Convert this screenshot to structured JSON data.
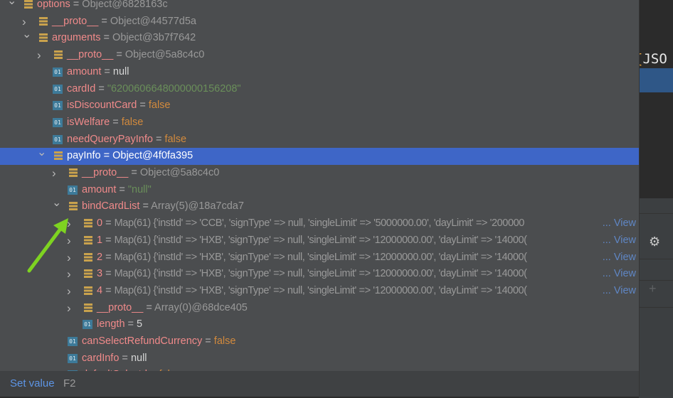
{
  "editor": {
    "code_brace": "{",
    "code_text": "JSO"
  },
  "tree": {
    "rows": [
      {
        "level": 0,
        "expand": "open",
        "icon": "object",
        "key": "options",
        "value": "Object@6828163c",
        "vtype": "ref"
      },
      {
        "level": 1,
        "expand": "closed",
        "icon": "object",
        "key": "__proto__",
        "value": "Object@44577d5a",
        "vtype": "ref"
      },
      {
        "level": 1,
        "expand": "open",
        "icon": "object",
        "key": "arguments",
        "value": "Object@3b7f7642",
        "vtype": "ref"
      },
      {
        "level": 2,
        "expand": "closed",
        "icon": "object",
        "key": "__proto__",
        "value": "Object@5a8c4c0",
        "vtype": "ref"
      },
      {
        "level": 2,
        "expand": "none",
        "icon": "primitive",
        "key": "amount",
        "value": "null",
        "vtype": "null"
      },
      {
        "level": 2,
        "expand": "none",
        "icon": "primitive",
        "key": "cardId",
        "value": "\"6200606648000000156208\"",
        "vtype": "str"
      },
      {
        "level": 2,
        "expand": "none",
        "icon": "primitive",
        "key": "isDiscountCard",
        "value": "false",
        "vtype": "bool"
      },
      {
        "level": 2,
        "expand": "none",
        "icon": "primitive",
        "key": "isWelfare",
        "value": "false",
        "vtype": "bool"
      },
      {
        "level": 2,
        "expand": "none",
        "icon": "primitive",
        "key": "needQueryPayInfo",
        "value": "false",
        "vtype": "bool"
      },
      {
        "level": 2,
        "expand": "open",
        "icon": "object",
        "key": "payInfo",
        "value": "Object@4f0fa395",
        "vtype": "ref",
        "selected": true
      },
      {
        "level": 3,
        "expand": "closed",
        "icon": "object",
        "key": "__proto__",
        "value": "Object@5a8c4c0",
        "vtype": "ref"
      },
      {
        "level": 3,
        "expand": "none",
        "icon": "primitive",
        "key": "amount",
        "value": "\"null\"",
        "vtype": "str"
      },
      {
        "level": 3,
        "expand": "open",
        "icon": "object",
        "key": "bindCardList",
        "value": "Array(5)@18a7cda7",
        "vtype": "ref"
      },
      {
        "level": 4,
        "expand": "closed",
        "icon": "object",
        "key": "0",
        "value": "Map(61) {'instId' => 'CCB', 'signType' => null, 'singleLimit' => '5000000.00', 'dayLimit' => '200000",
        "vtype": "map",
        "view": "View"
      },
      {
        "level": 4,
        "expand": "closed",
        "icon": "object",
        "key": "1",
        "value": "Map(61) {'instId' => 'HXB', 'signType' => null, 'singleLimit' => '12000000.00', 'dayLimit' => '14000(",
        "vtype": "map",
        "view": "View"
      },
      {
        "level": 4,
        "expand": "closed",
        "icon": "object",
        "key": "2",
        "value": "Map(61) {'instId' => 'HXB', 'signType' => null, 'singleLimit' => '12000000.00', 'dayLimit' => '14000(",
        "vtype": "map",
        "view": "View"
      },
      {
        "level": 4,
        "expand": "closed",
        "icon": "object",
        "key": "3",
        "value": "Map(61) {'instId' => 'HXB', 'signType' => null, 'singleLimit' => '12000000.00', 'dayLimit' => '14000(",
        "vtype": "map",
        "view": "View"
      },
      {
        "level": 4,
        "expand": "closed",
        "icon": "object",
        "key": "4",
        "value": "Map(61) {'instId' => 'HXB', 'signType' => null, 'singleLimit' => '12000000.00', 'dayLimit' => '14000(",
        "vtype": "map",
        "view": "View"
      },
      {
        "level": 4,
        "expand": "closed",
        "icon": "object",
        "key": "__proto__",
        "value": "Array(0)@68dce405",
        "vtype": "ref"
      },
      {
        "level": 4,
        "expand": "none",
        "icon": "primitive",
        "key": "length",
        "value": "5",
        "vtype": "num"
      },
      {
        "level": 3,
        "expand": "none",
        "icon": "primitive",
        "key": "canSelectRefundCurrency",
        "value": "false",
        "vtype": "bool"
      },
      {
        "level": 3,
        "expand": "none",
        "icon": "primitive",
        "key": "cardInfo",
        "value": "null",
        "vtype": "null"
      },
      {
        "level": 3,
        "expand": "none",
        "icon": "primitive",
        "key": "defaultSelectd",
        "value": "false",
        "vtype": "bool"
      }
    ]
  },
  "footer": {
    "action": "Set value",
    "shortcut": "F2"
  },
  "icons": {
    "object": "object-icon",
    "primitive": "primitive-icon",
    "gear": "gear-icon",
    "add_watch": "add-watch-icon",
    "annotation": "green-arrow-annotation"
  },
  "colors": {
    "selection": "#3e66c7",
    "annotation": "#7ed321",
    "key": "#f08a8a",
    "string": "#6a8f5a",
    "boolean": "#d28a3d",
    "link": "#5f86c4"
  }
}
